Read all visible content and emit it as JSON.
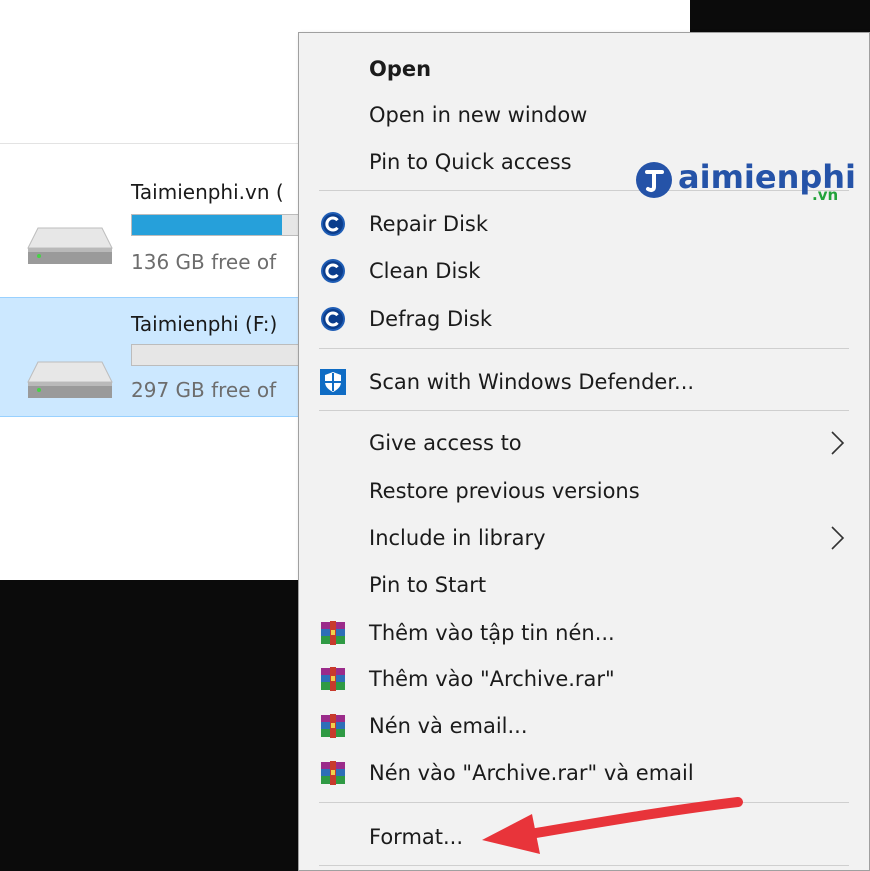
{
  "explorer": {
    "drives": [
      {
        "name": "Taimienphi.vn (",
        "free_text": "136 GB free of",
        "usage": 0.9,
        "selected": false
      },
      {
        "name": "Taimienphi (F:)",
        "free_text": "297 GB free of",
        "usage": 0.0,
        "selected": true
      }
    ]
  },
  "context_menu": {
    "items": [
      {
        "label": "Open",
        "bold": true
      },
      {
        "label": "Open in new window"
      },
      {
        "label": "Pin to Quick access"
      },
      {
        "label": "Repair Disk",
        "icon": "ccleaner-icon"
      },
      {
        "label": "Clean Disk",
        "icon": "ccleaner-icon"
      },
      {
        "label": "Defrag Disk",
        "icon": "ccleaner-icon"
      },
      {
        "label": "Scan with Windows Defender...",
        "icon": "windows-defender-icon"
      },
      {
        "label": "Give access to",
        "submenu": true
      },
      {
        "label": "Restore previous versions"
      },
      {
        "label": "Include in library",
        "submenu": true
      },
      {
        "label": "Pin to Start"
      },
      {
        "label": "Thêm vào tập tin nén...",
        "icon": "winrar-icon"
      },
      {
        "label": "Thêm vào \"Archive.rar\"",
        "icon": "winrar-icon"
      },
      {
        "label": "Nén và email...",
        "icon": "winrar-icon"
      },
      {
        "label": "Nén vào \"Archive.rar\" và email",
        "icon": "winrar-icon"
      },
      {
        "label": "Format..."
      }
    ]
  },
  "watermark": {
    "brand": "aimienphi",
    "sub": ".vn"
  },
  "colors": {
    "accent": "#26a0da",
    "selection": "#cce8ff",
    "menu_bg": "#f2f2f2",
    "annotation_arrow": "#e8343a",
    "logo_blue": "#2553a8",
    "logo_green": "#22a33a"
  }
}
